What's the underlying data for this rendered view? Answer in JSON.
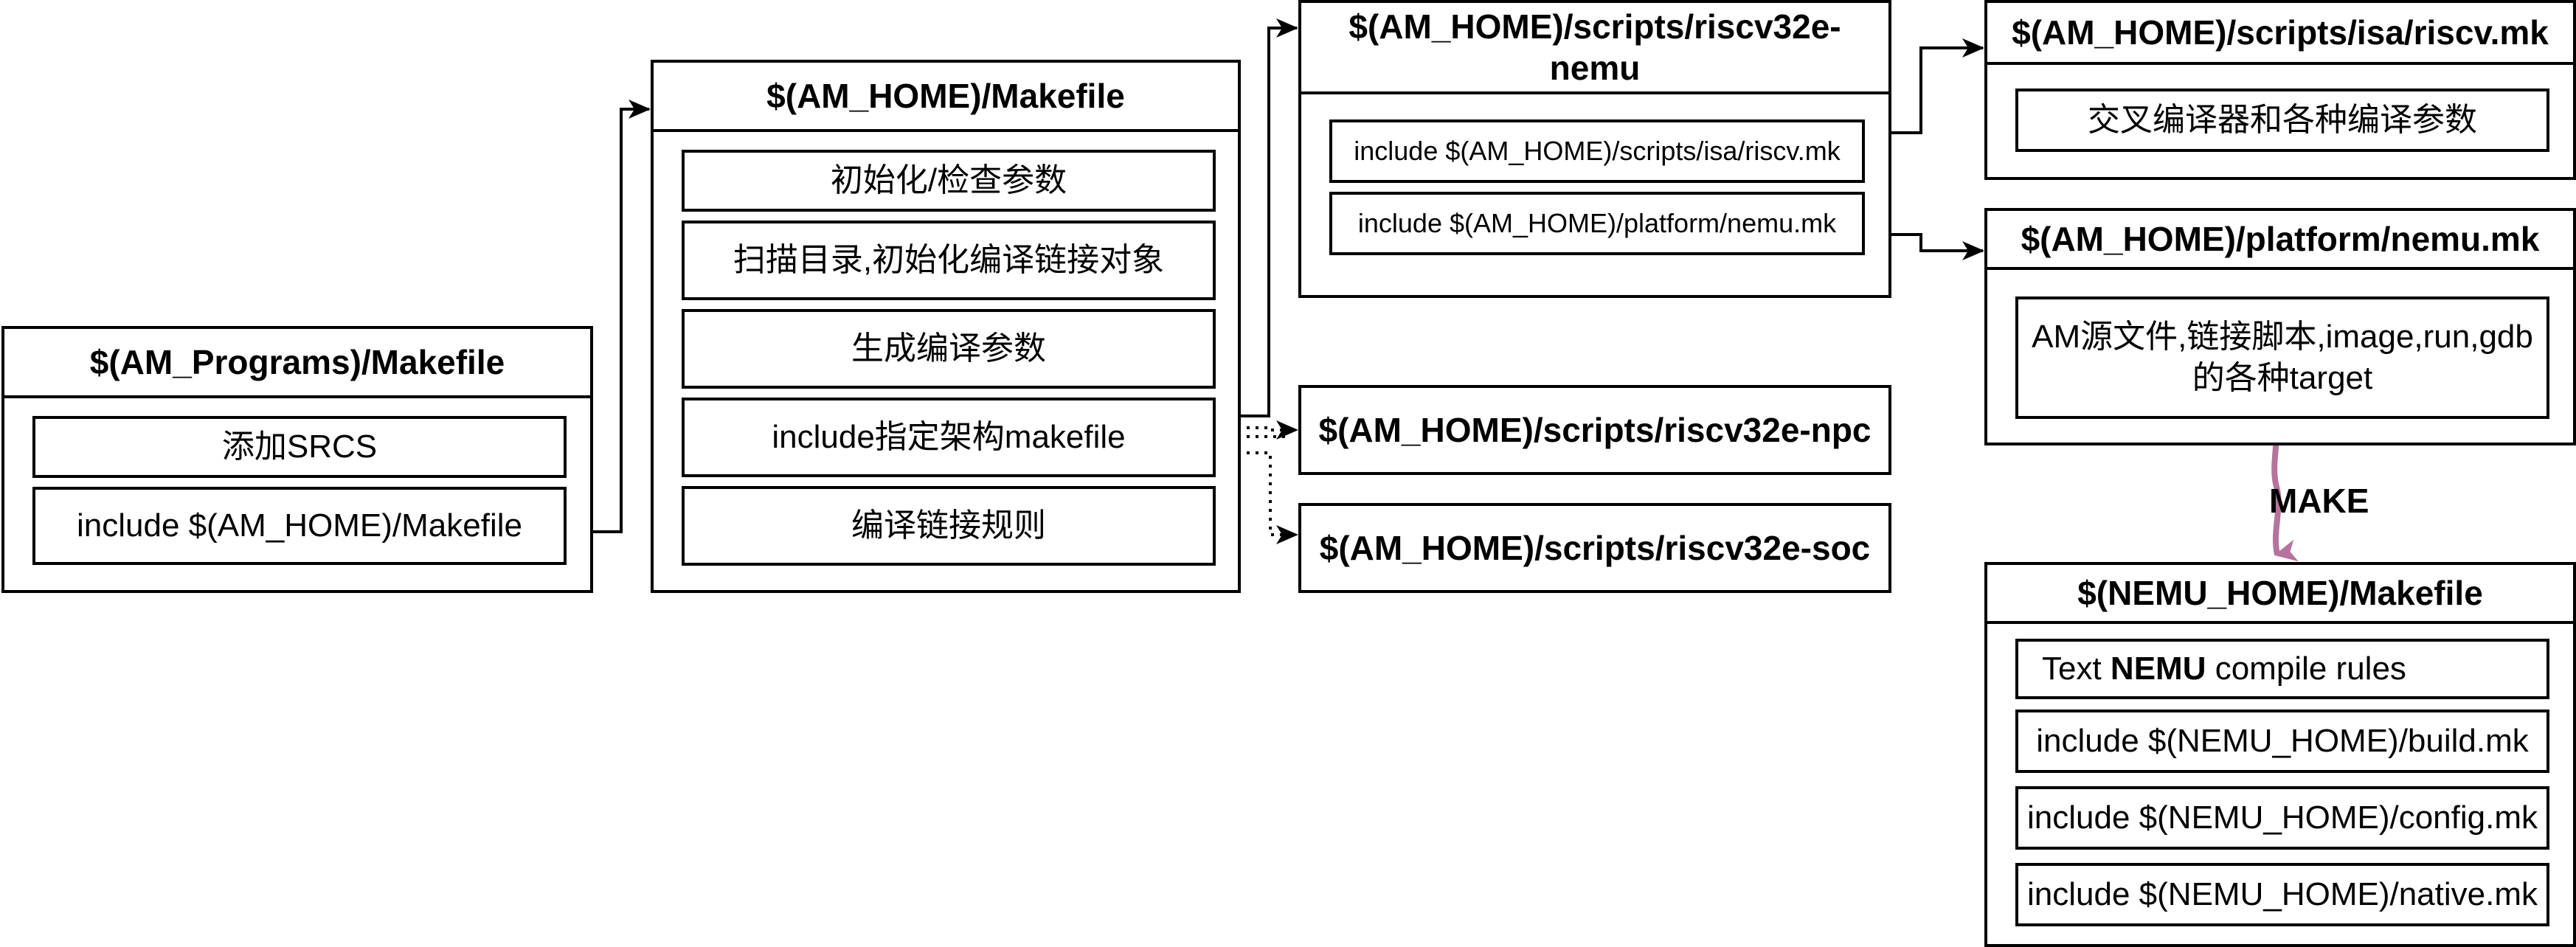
{
  "am_programs": {
    "title": "$(AM_Programs)/Makefile",
    "items": [
      "添加SRCS",
      "include $(AM_HOME)/Makefile"
    ]
  },
  "am_makefile": {
    "title": "$(AM_HOME)/Makefile",
    "items": [
      "初始化/检查参数",
      "扫描目录,初始化编译链接对象",
      "生成编译参数",
      "include指定架构makefile",
      "编译链接规则"
    ]
  },
  "riscv32e_nemu": {
    "title": "$(AM_HOME)/scripts/riscv32e-nemu",
    "items": [
      "include $(AM_HOME)/scripts/isa/riscv.mk",
      "include $(AM_HOME)/platform/nemu.mk"
    ]
  },
  "riscv32e_npc": {
    "title": "$(AM_HOME)/scripts/riscv32e-npc"
  },
  "riscv32e_soc": {
    "title": "$(AM_HOME)/scripts/riscv32e-soc"
  },
  "isa_riscv": {
    "title": "$(AM_HOME)/scripts/isa/riscv.mk",
    "items": [
      "交叉编译器和各种编译参数"
    ]
  },
  "platform_nemu": {
    "title": "$(AM_HOME)/platform/nemu.mk",
    "items": [
      "AM源文件,链接脚本,image,run,gdb的各种target"
    ]
  },
  "nemu_makefile": {
    "title": "$(NEMU_HOME)/Makefile",
    "text_prefix": "Text ",
    "text_bold": "NEMU",
    "text_suffix": " compile rules",
    "items": [
      "include $(NEMU_HOME)/build.mk",
      "include $(NEMU_HOME)/config.mk",
      "include $(NEMU_HOME)/native.mk"
    ]
  },
  "make_label": "MAKE",
  "colors": {
    "stroke": "#000000",
    "make_arrow": "#b5739d"
  }
}
